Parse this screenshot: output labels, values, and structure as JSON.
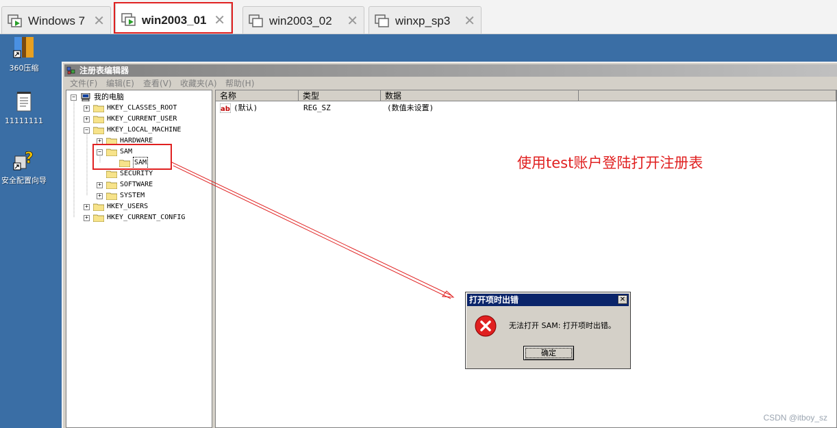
{
  "tabs": [
    {
      "label": "Windows 7",
      "active": false
    },
    {
      "label": "win2003_01",
      "active": true
    },
    {
      "label": "win2003_02",
      "active": false
    },
    {
      "label": "winxp_sp3",
      "active": false
    }
  ],
  "desktop": {
    "icons": [
      {
        "label": "360压缩",
        "icon": "archive-icon"
      },
      {
        "label": "11111111",
        "icon": "text-file-icon"
      },
      {
        "label": "安全配置向导",
        "icon": "security-wizard-icon"
      }
    ]
  },
  "regedit": {
    "title": "注册表编辑器",
    "menu": [
      "文件(F)",
      "编辑(E)",
      "查看(V)",
      "收藏夹(A)",
      "帮助(H)"
    ],
    "tree": {
      "root": "我的电脑",
      "nodes": [
        "HKEY_CLASSES_ROOT",
        "HKEY_CURRENT_USER",
        "HKEY_LOCAL_MACHINE",
        "HARDWARE",
        "SAM",
        "SAM",
        "SECURITY",
        "SOFTWARE",
        "SYSTEM",
        "HKEY_USERS",
        "HKEY_CURRENT_CONFIG"
      ]
    },
    "columns": [
      "名称",
      "类型",
      "数据"
    ],
    "rows": [
      {
        "name": "(默认)",
        "type": "REG_SZ",
        "data": "(数值未设置)"
      }
    ]
  },
  "annotation": "使用test账户登陆打开注册表",
  "dialog": {
    "title": "打开项时出错",
    "message": "无法打开 SAM: 打开项时出错。",
    "ok_label": "确定",
    "close_glyph": "✕"
  },
  "watermark": "CSDN @itboy_sz",
  "colors": {
    "annotation": "#e02020",
    "desktop": "#3a6ea5",
    "dialog_title": "#0a246a"
  }
}
